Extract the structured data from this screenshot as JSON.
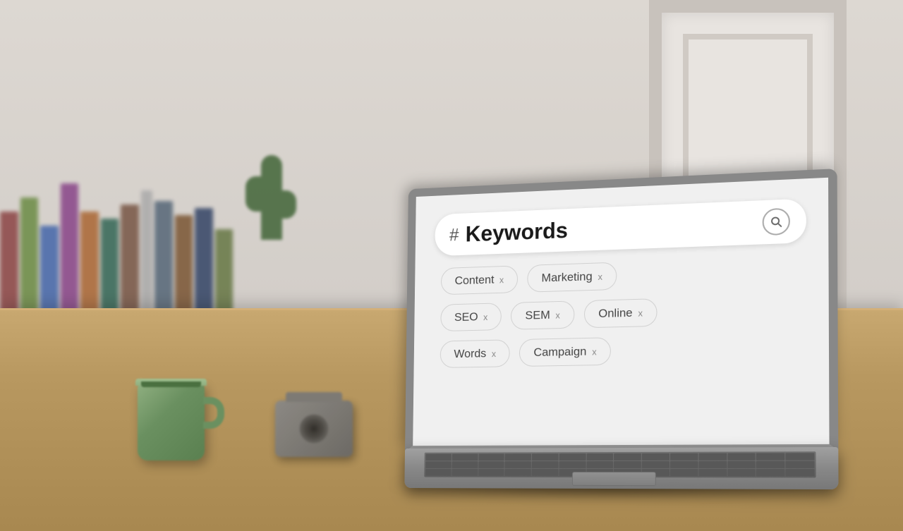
{
  "scene": {
    "search_bar": {
      "hash": "#",
      "placeholder": "Keywords",
      "search_icon_label": "search"
    },
    "tags": [
      {
        "row": 0,
        "items": [
          {
            "label": "Content",
            "close": "x"
          },
          {
            "label": "Marketing",
            "close": "x"
          }
        ]
      },
      {
        "row": 1,
        "items": [
          {
            "label": "SEO",
            "close": "x"
          },
          {
            "label": "SEM",
            "close": "x"
          },
          {
            "label": "Online",
            "close": "x"
          }
        ]
      },
      {
        "row": 2,
        "items": [
          {
            "label": "Words",
            "close": "x"
          },
          {
            "label": "Campaign",
            "close": "x"
          }
        ]
      }
    ]
  }
}
